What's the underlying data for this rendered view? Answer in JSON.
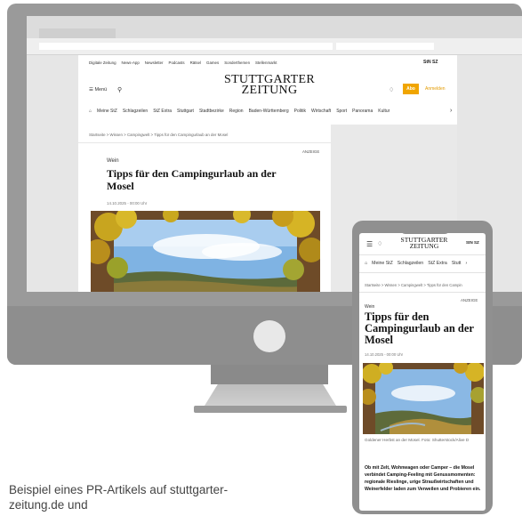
{
  "desktop": {
    "topnav": [
      "Digitale Zeitung",
      "News-App",
      "Newsletter",
      "Podcasts",
      "Rätsel",
      "Games",
      "Sonderthemen",
      "Stellenmarkt"
    ],
    "top_logos": "StN SZ",
    "menu_label": "Menü",
    "logo_line1": "STUTTGARTER",
    "logo_line2": "ZEITUNG",
    "abo_label": "Abo",
    "login_label": "Anmelden",
    "categories": [
      "Meine StZ",
      "Schlagzeilen",
      "StZ Extra",
      "Stuttgart",
      "Stadtbezirke",
      "Region",
      "Baden-Württemberg",
      "Politik",
      "Wirtschaft",
      "Sport",
      "Panorama",
      "Kultur"
    ],
    "breadcrumb": "Startseite  >  Wissen  >  Campingwelt  >  Tipps für den Campingurlaub an der Mosel",
    "anzeige": "ANZEIGE",
    "kicker": "Wein",
    "title": "Tipps für den Campingurlaub an der Mosel",
    "date": "14.10.2025 - 00:00 Uhr"
  },
  "mobile": {
    "logo_line1": "STUTTGARTER",
    "logo_line2": "ZEITUNG",
    "top_logos": "StN SZ",
    "categories": [
      "Meine StZ",
      "Schlagzeilen",
      "StZ Extra",
      "Stutt"
    ],
    "breadcrumb": "Startseite  >  Wissen  >  Campingwelt  >  Tipps für den Campin",
    "anzeige": "ANZEIGE",
    "kicker": "Wein",
    "title": "Tipps für den Campingurlaub an der Mosel",
    "date": "14.10.2025 - 00:00 Uhr",
    "caption": "Goldener Herbst an der Mosel. Foto: Shutterstock/Alive D",
    "body": "Ob mit Zelt, Wohnwagen oder Camper – die Mosel verbindet Camping-Feeling mit Genussmomenten: regionale Rieslinge, urige Straußwirtschaften und Weinerfelder laden zum Verweilen und Probieren ein."
  },
  "caption": "Beispiel eines PR-Artikels auf stuttgarter-zeitung.de und"
}
